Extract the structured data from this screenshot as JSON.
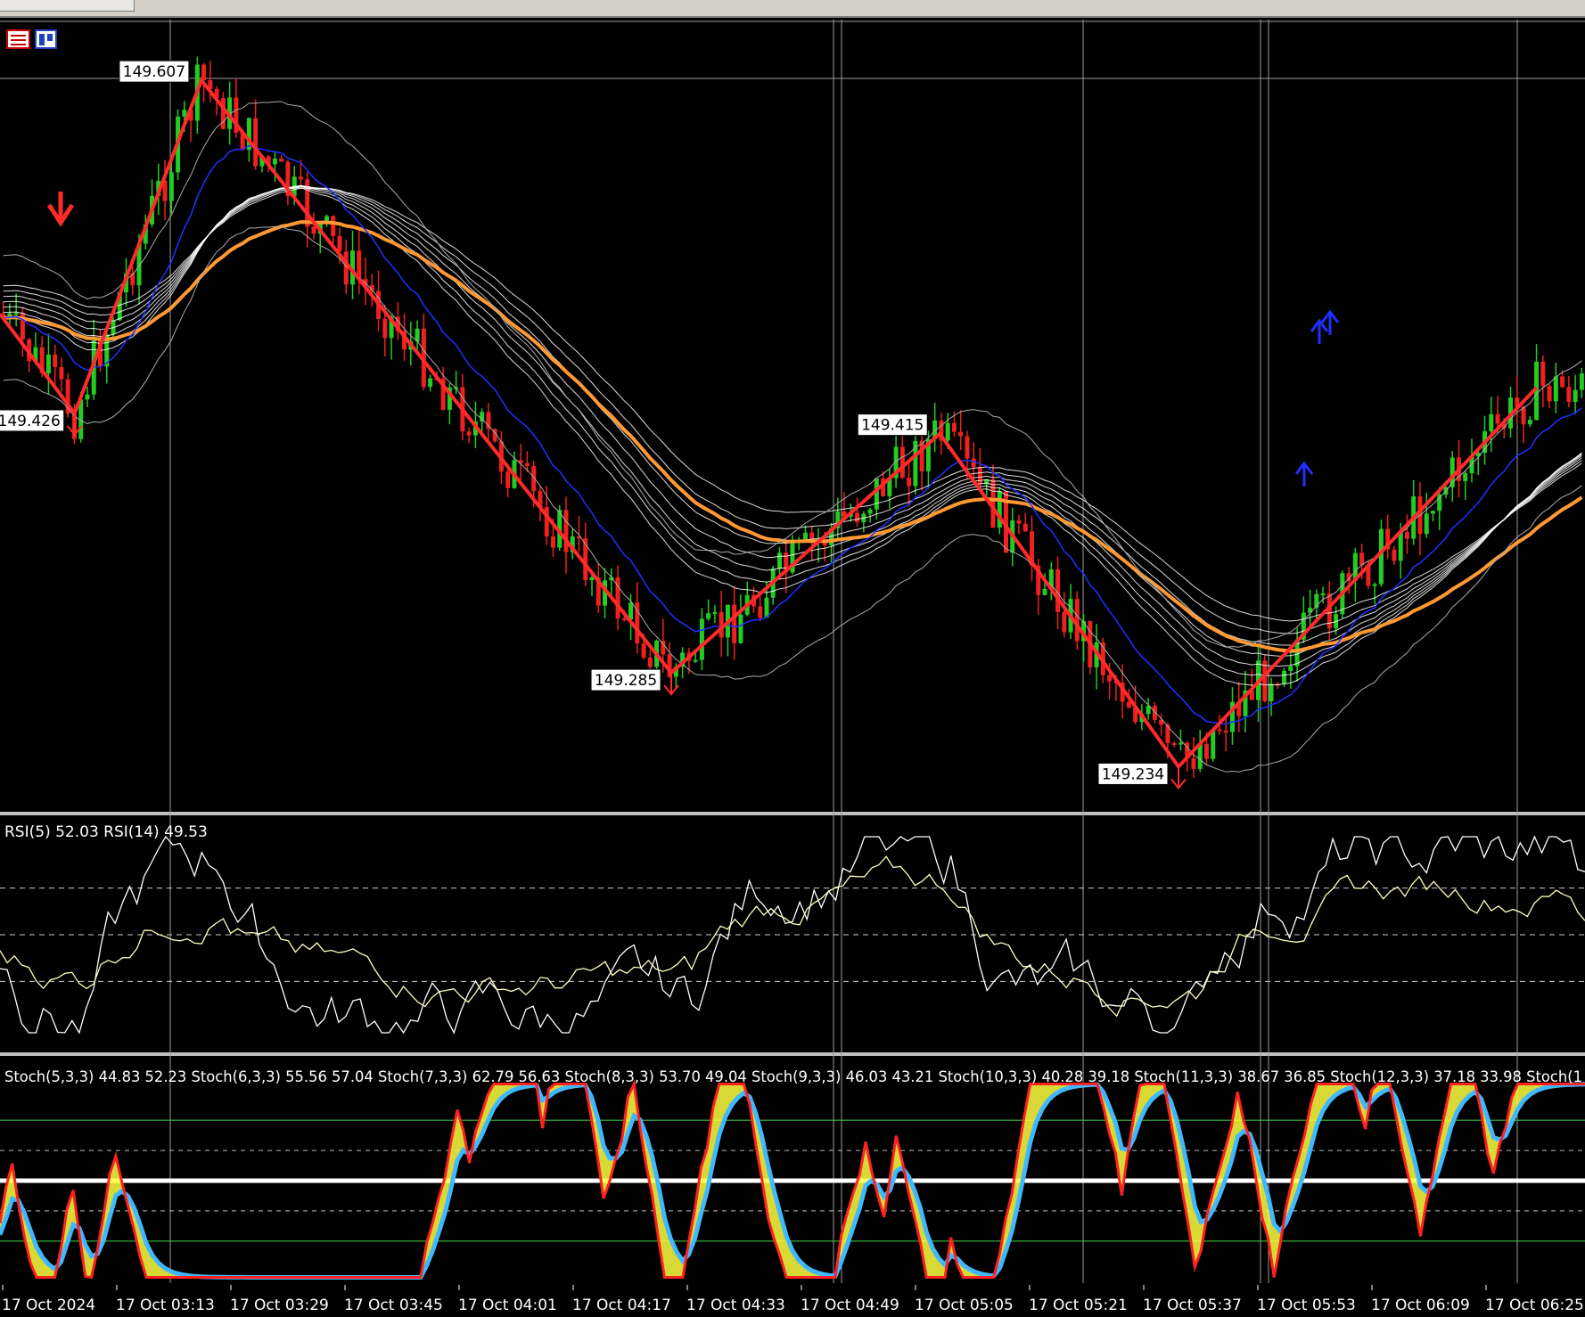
{
  "chart_data": [
    {
      "type": "line",
      "title": "",
      "instrument_note": "",
      "zigzag_points": [
        {
          "x": "17 Oct 2024 02:59",
          "y": 149.48
        },
        {
          "x": "17 Oct 2024 03:09",
          "y": 149.426
        },
        {
          "x": "17 Oct 2024 03:26",
          "y": 149.607
        },
        {
          "x": "17 Oct 2024 04:29",
          "y": 149.285
        },
        {
          "x": "17 Oct 2024 05:05",
          "y": 149.415
        },
        {
          "x": "17 Oct 2024 05:37",
          "y": 149.234
        },
        {
          "x": "17 Oct 2024 06:25",
          "y": 149.44
        }
      ],
      "price_labels": [
        "149.607",
        "149.426",
        "149.415",
        "149.285",
        "149.234"
      ],
      "ylim": [
        149.21,
        149.64
      ],
      "grid": true
    },
    {
      "type": "line",
      "title": "RSI(5) 52.03 RSI(14) 49.53",
      "series": [
        {
          "name": "RSI(5)",
          "last_value": 52.03,
          "color": "#ffffff"
        },
        {
          "name": "RSI(14)",
          "last_value": 49.53,
          "color": "#ffffc0"
        }
      ],
      "levels": [
        30,
        50,
        70
      ],
      "ylim": [
        0,
        100
      ]
    },
    {
      "type": "line",
      "title": "Stoch(5,3,3) 44.83 52.23 Stoch(6,3,3) 55.56 57.04 Stoch(7,3,3) 62.79 56.63 Stoch(8,3,3) 53.70 49.04 Stoch(9,3,3) 46.03 43.21 Stoch(10,3,3) 40.28 39.18 Stoch(11,3,3) 38.67 36.85 Stoch(12,3,3) 37.18 33.98 Stoch(1",
      "series": [
        {
          "name": "Stoch fast",
          "color": "#ff2020"
        },
        {
          "name": "Stoch slow",
          "color": "#40b8ff"
        },
        {
          "name": "Stoch band",
          "color": "#ffff40"
        }
      ],
      "levels": [
        20,
        50,
        80
      ],
      "ylim": [
        0,
        100
      ]
    }
  ],
  "x_ticks": [
    "17 Oct 2024",
    "17 Oct 03:13",
    "17 Oct 03:29",
    "17 Oct 03:45",
    "17 Oct 04:01",
    "17 Oct 04:17",
    "17 Oct 04:33",
    "17 Oct 04:49",
    "17 Oct 05:05",
    "17 Oct 05:21",
    "17 Oct 05:37",
    "17 Oct 05:53",
    "17 Oct 06:09",
    "17 Oct 06:25"
  ],
  "colors": {
    "background": "#000000",
    "bull_candle": "#22cc22",
    "bear_candle": "#ee2020",
    "zigzag": "#ff2a2a",
    "ma_bundle": "#ffffff",
    "ma_slow": "#ff9933",
    "ma_fast": "#2030ff",
    "grid": "#ffffff"
  }
}
